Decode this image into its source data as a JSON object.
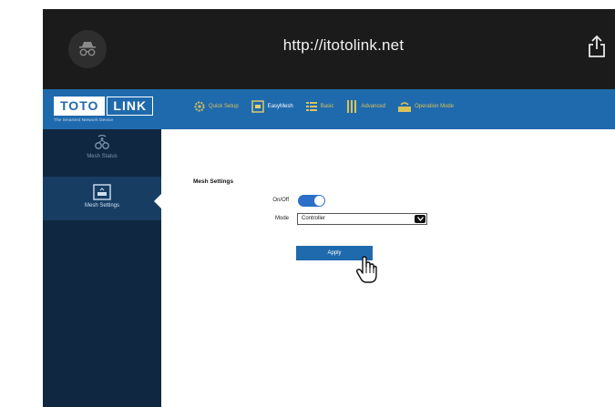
{
  "browser": {
    "url": "http://itotolink.net",
    "icons": [
      "incognito-icon",
      "share-icon"
    ]
  },
  "router": {
    "logo": {
      "left": "TOTO",
      "right": "LINK",
      "tagline": "The Smartest Network Device"
    },
    "nav": [
      {
        "label": "Quick Setup",
        "icon": "gear-icon"
      },
      {
        "label": "EasyMesh",
        "icon": "mesh-icon",
        "active": true
      },
      {
        "label": "Basic",
        "icon": "list-icon"
      },
      {
        "label": "Advanced",
        "icon": "bars-icon"
      },
      {
        "label": "Operation Mode",
        "icon": "wifi-icon"
      }
    ],
    "sidebar": [
      {
        "label": "Mesh Status",
        "icon": "mesh-status-icon"
      },
      {
        "label": "Mesh Settings",
        "icon": "mesh-settings-icon",
        "active": true
      }
    ]
  },
  "content": {
    "section_title": "Mesh Settings",
    "onoff_label": "On/Off",
    "onoff_state": "on",
    "mode_label": "Mode",
    "mode_value": "Controller",
    "apply_label": "Apply"
  },
  "colors": {
    "nav_bg": "#1f6aad",
    "sidebar_bg": "#0f2740",
    "browser_bg": "#1b1b1b",
    "toggle_on": "#2b6fc9"
  }
}
